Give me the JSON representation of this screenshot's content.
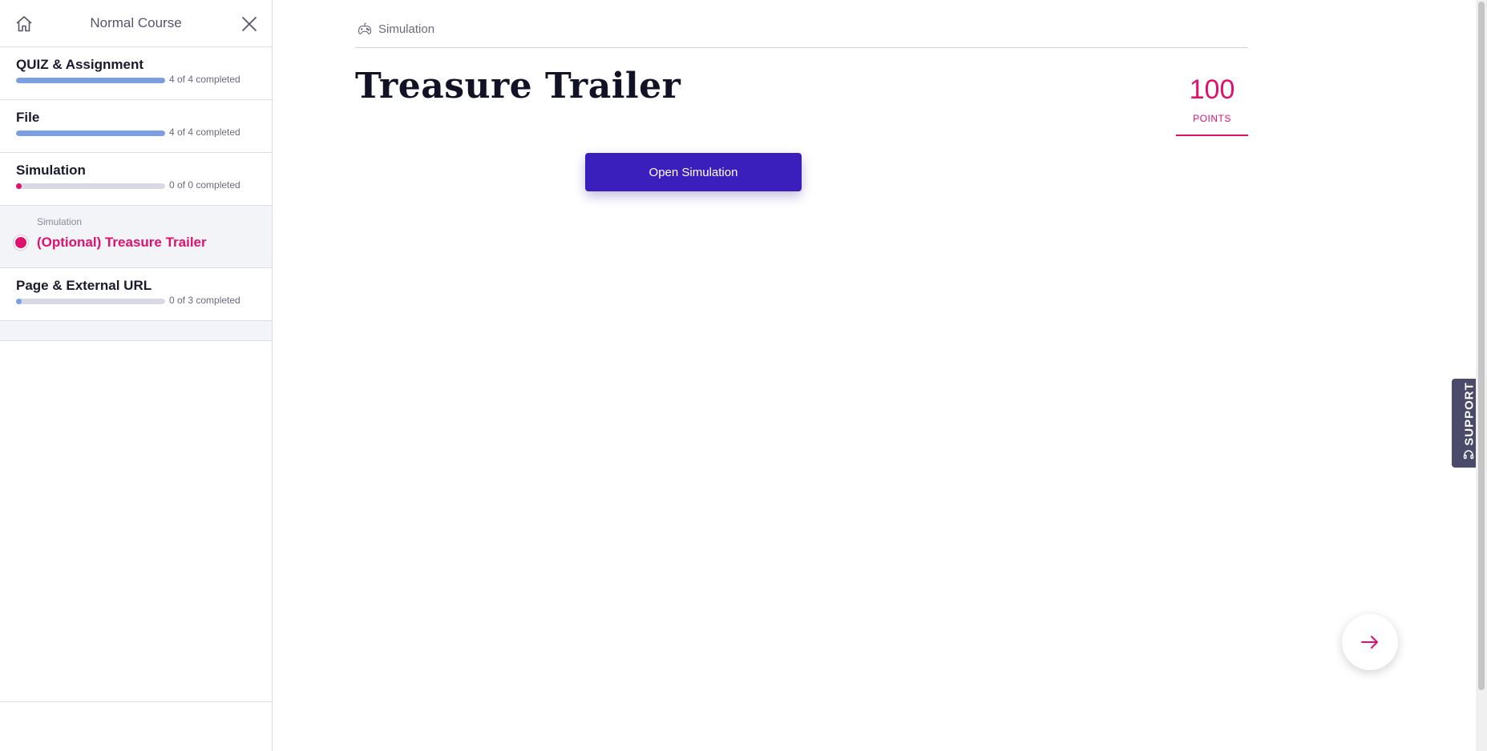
{
  "sidebar": {
    "title": "Normal Course",
    "sections": [
      {
        "title": "QUIZ & Assignment",
        "progress_text": "4 of 4 completed",
        "progress": 1.0,
        "color": "#7b9fe0"
      },
      {
        "title": "File",
        "progress_text": "4 of 4 completed",
        "progress": 1.0,
        "color": "#7b9fe0"
      },
      {
        "title": "Simulation",
        "progress_text": "0 of 0 completed",
        "progress": 0.0,
        "color": "#e0106d"
      },
      {
        "title": "Page & External URL",
        "progress_text": "0 of 3 completed",
        "progress": 0.0,
        "color": "#7b9fe0"
      }
    ],
    "current_item": {
      "type": "Simulation",
      "title": "(Optional) Treasure Trailer"
    }
  },
  "main": {
    "breadcrumb": "Simulation",
    "title": "Treasure Trailer",
    "points_value": "100",
    "points_label": "POINTS",
    "open_button": "Open Simulation"
  },
  "support": {
    "label": "SUPPORT"
  },
  "colors": {
    "accent": "#e0106d",
    "primary_button": "#3a1fbd",
    "progress": "#7b9fe0"
  },
  "icons": {
    "home": "home-icon",
    "close": "close-icon",
    "breadcrumb": "gamepad-icon",
    "next": "arrow-right-icon",
    "support": "headset-icon"
  }
}
